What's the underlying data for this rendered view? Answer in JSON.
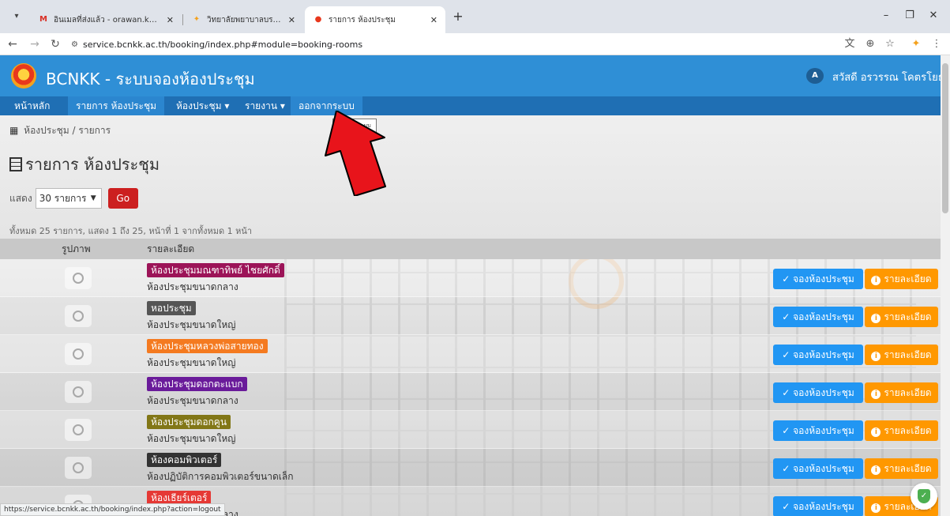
{
  "browser": {
    "tabs": [
      {
        "title": "อินเมลที่ส่งแล้ว - orawan.k@bcnkk.ac.th",
        "favicon": "gmail-icon"
      },
      {
        "title": "วิทยาลัยพยาบาลบรมราชชนนี ขอนแก่น",
        "favicon": "college-icon"
      },
      {
        "title": "รายการ ห้องประชุม",
        "favicon": "booking-icon"
      }
    ],
    "url": "service.bcnkk.ac.th/booking/index.php#module=booking-rooms",
    "status_url": "https://service.bcnkk.ac.th/booking/index.php?action=logout"
  },
  "header": {
    "brand": "BCNKK - ระบบจองห้องประชุม",
    "user_initials": "A",
    "user_name": "สวัสดี อรวรรณ โคตรโยธา"
  },
  "menu": [
    {
      "label": "หน้าหลัก"
    },
    {
      "label": "รายการ ห้องประชุม"
    },
    {
      "label": "ห้องประชุม ▾"
    },
    {
      "label": "รายงาน ▾"
    },
    {
      "label": "ออกจากระบบ"
    }
  ],
  "tooltip": "ออกจากระบบ",
  "breadcrumb": "ห้องประชุม / รายการ",
  "page_title": "รายการ ห้องประชุม",
  "filter": {
    "label": "แสดง",
    "selected": "30 รายการ",
    "go_label": "Go"
  },
  "summary": "ทั้งหมด 25 รายการ, แสดง 1 ถึง 25, หน้าที่ 1 จากทั้งหมด 1 หน้า",
  "table": {
    "columns": [
      "รูปภาพ",
      "รายละเอียด"
    ],
    "book_label": "จองห้องประชุม",
    "detail_label": "รายละเอียด",
    "rows": [
      {
        "name": "ห้องประชุมมณฑาทิพย์ ไชยศักดิ์",
        "desc": "ห้องประชุมขนาดกลาง",
        "color": "#9c1458"
      },
      {
        "name": "หอประชุม",
        "desc": "ห้องประชุมขนาดใหญ่",
        "color": "#555555"
      },
      {
        "name": "ห้องประชุมหลวงพ่อสายทอง",
        "desc": "ห้องประชุมขนาดใหญ่",
        "color": "#f47a20"
      },
      {
        "name": "ห้องประชุมดอกตะแบก",
        "desc": "ห้องประชุมขนาดกลาง",
        "color": "#6a1b9a"
      },
      {
        "name": "ห้องประชุมดอกคูน",
        "desc": "ห้องประชุมขนาดใหญ่",
        "color": "#827717"
      },
      {
        "name": "ห้องคอมพิวเตอร์",
        "desc": "ห้องปฏิบัติการคอมพิวเตอร์ขนาดเล็ก",
        "color": "#333333"
      },
      {
        "name": "ห้องเธียร์เตอร์",
        "desc": "ห้องประชุมขนาดกลาง",
        "color": "#e53935"
      }
    ]
  }
}
